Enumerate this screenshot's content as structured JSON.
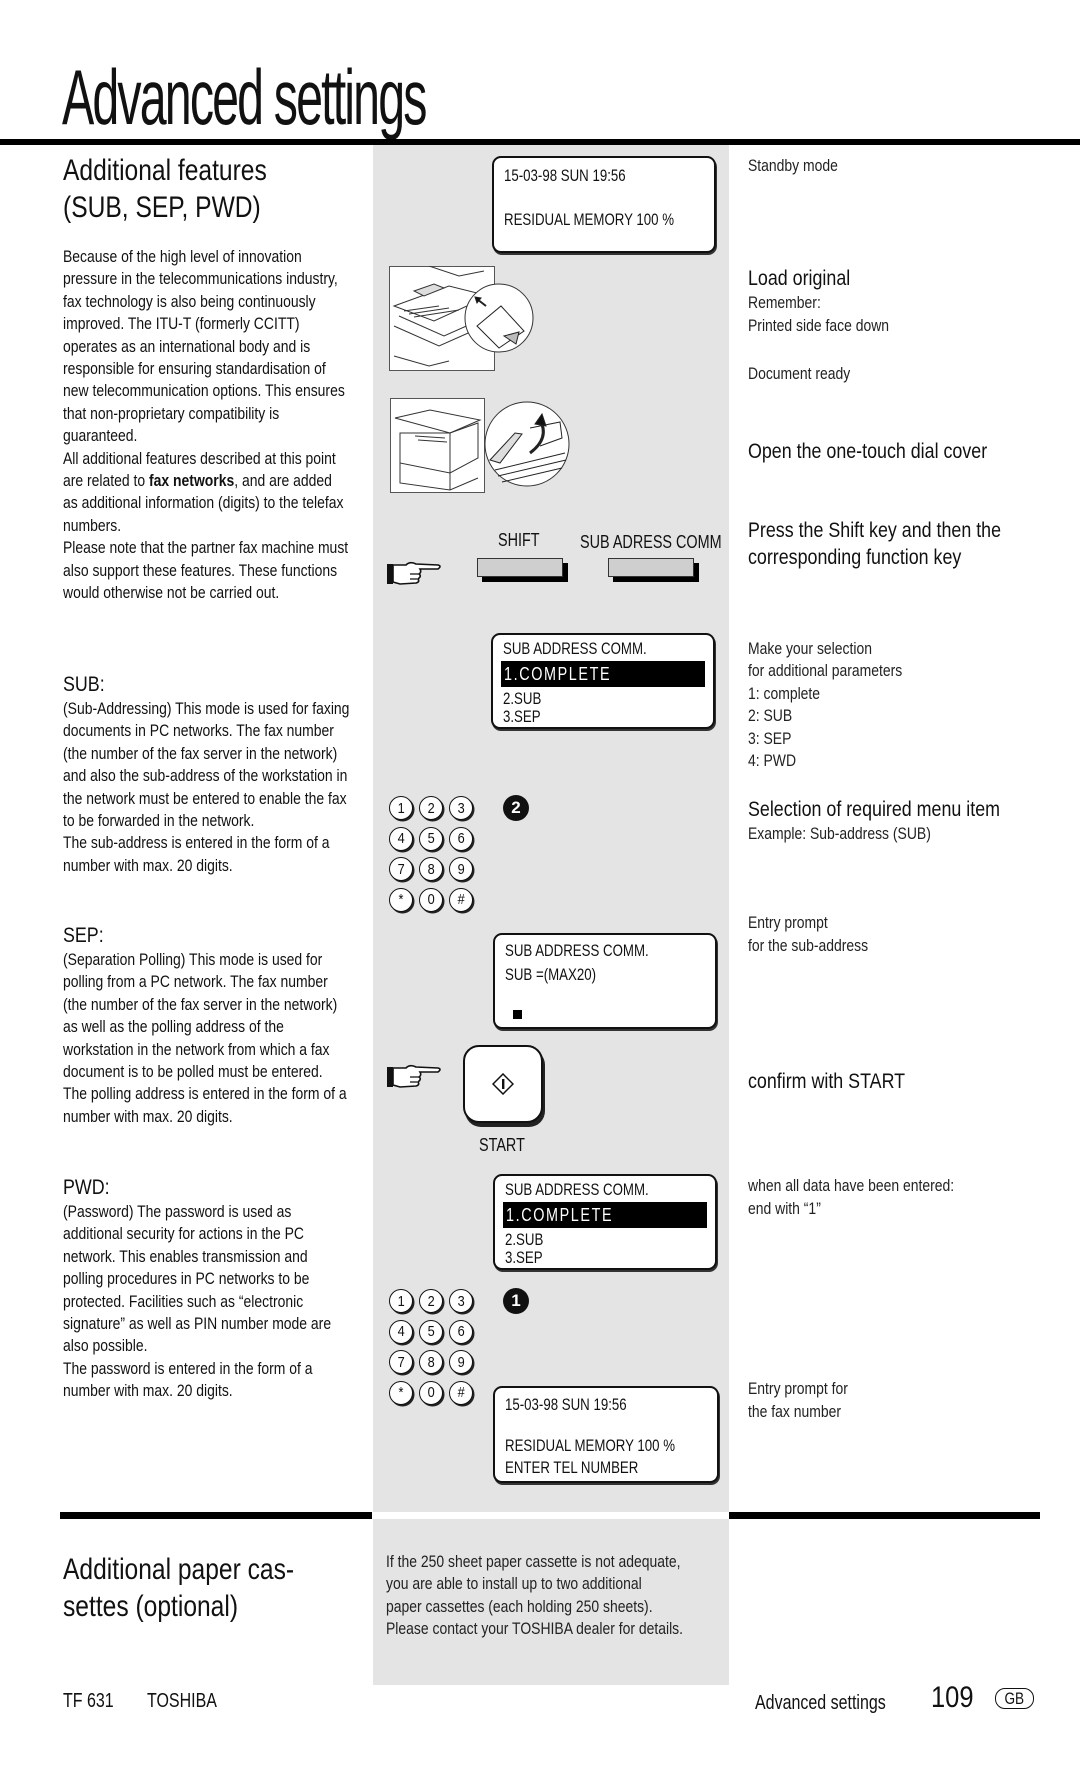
{
  "header": {
    "title": "Advanced settings"
  },
  "section_features": {
    "title_lines": [
      "Additional  features",
      "(SUB,  SEP,  PWD)"
    ],
    "intro": {
      "part1": "Because of the high level of innovation pressure in the telecommunications industry, fax technology is also being continuously improved. The ITU-T (formerly CCITT) operates as an international body and is responsible for ensuring standardisation of new telecommunication options. This ensures that non-proprietary compatibility is guaranteed.",
      "part2_before": "All additional features described at this point are related to ",
      "part2_bold": "fax networks",
      "part2_after": ", and are added as additional information (digits) to the telefax numbers.",
      "part3": "Please note that the partner fax machine must also support these features. These functions would otherwise not be carried out."
    },
    "sub": {
      "heading": "SUB:",
      "text": "(Sub-Addressing) This mode is used for faxing documents in PC networks. The fax number (the number of the fax server in the network) and also the sub-address of the workstation in the network must be entered to enable the fax to be forwarded in the network.",
      "text2": "The sub-address is entered in the form of a number with max. 20 digits."
    },
    "sep": {
      "heading": "SEP:",
      "text": "(Separation Polling) This mode is used for polling from a PC network. The fax number (the number of the fax server in the network) as well as the polling address of the workstation in the network from which a fax document is to be polled must be entered.",
      "text2": "The polling address is entered in the form of a number with max. 20 digits."
    },
    "pwd": {
      "heading": "PWD:",
      "text": "(Password) The password is used as additional security for actions in the PC network. This enables transmission and polling procedures in PC networks to be protected. Facilities such as “electronic signature” as well as PIN number mode are also possible.",
      "text2": "The password is entered in the form of a number with max. 20 digits."
    }
  },
  "displays": {
    "standby": {
      "line1": "15-03-98    SUN    19:56",
      "line2": "RESIDUAL  MEMORY 100 %"
    },
    "menu1": {
      "title": "SUB ADDRESS COMM.",
      "highlight": "1.COMPLETE",
      "item2": "2.SUB",
      "item3": "3.SEP"
    },
    "entry": {
      "title": "SUB ADDRESS COMM.",
      "line2": "SUB =(MAX20)"
    },
    "menu2": {
      "title": "SUB ADDRESS COMM.",
      "highlight": "1.COMPLETE",
      "item2": "2.SUB",
      "item3": "3.SEP"
    },
    "final": {
      "line1": "15-03-98    SUN    19:56",
      "line2": "RESIDUAL  MEMORY 100 %",
      "line3": "ENTER TEL NUMBER"
    }
  },
  "panel": {
    "shift_label": "SHIFT",
    "sub_label": "SUB ADRESS COMM",
    "start_label": "START",
    "keys": [
      "1",
      "2",
      "3",
      "4",
      "5",
      "6",
      "7",
      "8",
      "9",
      "*",
      "0",
      "#"
    ],
    "step1_digit": "2",
    "step2_digit": "1"
  },
  "instructions": {
    "standby": "Standby mode",
    "load_title": "Load original",
    "load_l1": "Remember:",
    "load_l2": "Printed side face down",
    "doc_ready": "Document ready",
    "open_cover": "Open the one-touch dial cover",
    "press_l1": "Press the Shift key and then the",
    "press_l2": "corresponding function key",
    "select_lines": [
      "Make your selection",
      "for additional parameters",
      "1:  complete",
      "2: SUB",
      "3:  SEP",
      "4: PWD"
    ],
    "required_title": "Selection of required menu item",
    "required_example": "Example: Sub-address (SUB)",
    "entry_l1": "Entry prompt",
    "entry_l2": "for the sub-address",
    "confirm": "confirm with START",
    "end_l1": "when all data have been entered:",
    "end_l2": "end with “1”",
    "fax_l1": "Entry prompt for",
    "fax_l2": "the fax number"
  },
  "section_cassettes": {
    "title_lines": [
      "Additional  paper  cas-",
      "settes  (optional)"
    ],
    "text_lines": [
      "If the 250 sheet paper cassette is not adequate,",
      "you are able to install up to two additional",
      "paper cassettes (each holding 250 sheets).",
      "Please contact your TOSHIBA dealer for details."
    ]
  },
  "footer": {
    "model": "TF 631",
    "brand": "TOSHIBA",
    "section": "Advanced settings",
    "page": "109",
    "lang": "GB"
  }
}
